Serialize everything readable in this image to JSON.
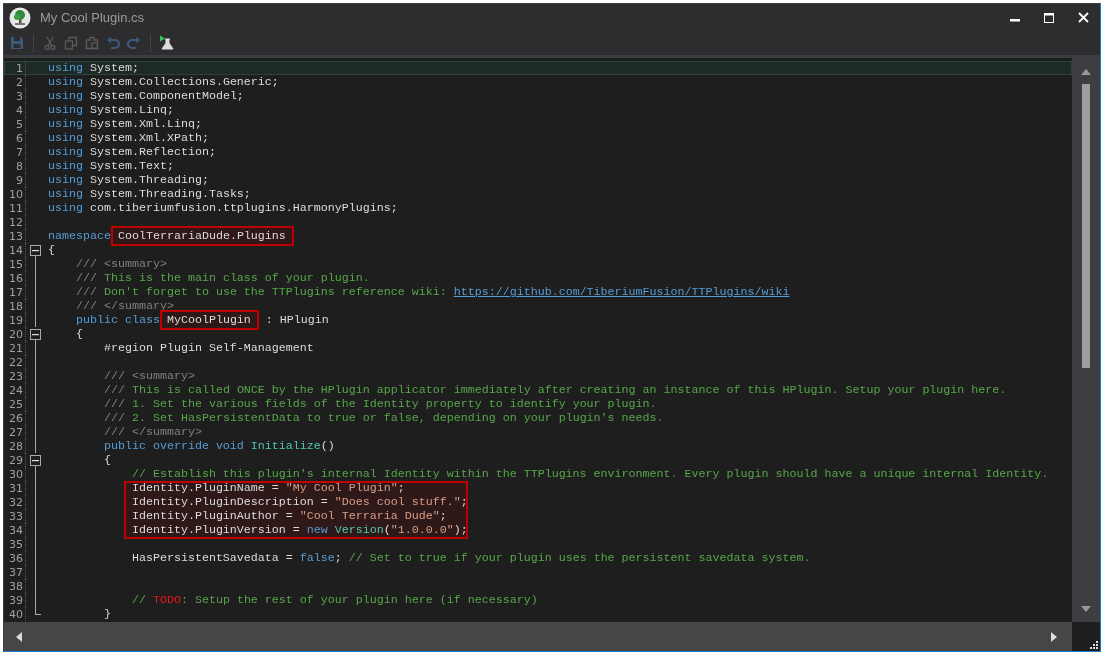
{
  "window": {
    "title": "My Cool Plugin.cs"
  },
  "editor": {
    "lines": [
      {
        "number": "1",
        "kind": "plain",
        "current": true,
        "boxed": false,
        "tokens": [
          {
            "kind": "keyword",
            "text": "using"
          },
          {
            "kind": "plain",
            "text": " System;"
          }
        ]
      },
      {
        "number": "2",
        "kind": "plain",
        "current": false,
        "boxed": false,
        "tokens": [
          {
            "kind": "keyword",
            "text": "using"
          },
          {
            "kind": "plain",
            "text": " System.Collections.Generic;"
          }
        ]
      },
      {
        "number": "3",
        "kind": "plain",
        "current": false,
        "boxed": false,
        "tokens": [
          {
            "kind": "keyword",
            "text": "using"
          },
          {
            "kind": "plain",
            "text": " System.ComponentModel;"
          }
        ]
      },
      {
        "number": "4",
        "kind": "plain",
        "current": false,
        "boxed": false,
        "tokens": [
          {
            "kind": "keyword",
            "text": "using"
          },
          {
            "kind": "plain",
            "text": " System.Linq;"
          }
        ]
      },
      {
        "number": "5",
        "kind": "plain",
        "current": false,
        "boxed": false,
        "tokens": [
          {
            "kind": "keyword",
            "text": "using"
          },
          {
            "kind": "plain",
            "text": " System.Xml.Linq;"
          }
        ]
      },
      {
        "number": "6",
        "kind": "plain",
        "current": false,
        "boxed": false,
        "tokens": [
          {
            "kind": "keyword",
            "text": "using"
          },
          {
            "kind": "plain",
            "text": " System.Xml.XPath;"
          }
        ]
      },
      {
        "number": "7",
        "kind": "plain",
        "current": false,
        "boxed": false,
        "tokens": [
          {
            "kind": "keyword",
            "text": "using"
          },
          {
            "kind": "plain",
            "text": " System.Reflection;"
          }
        ]
      },
      {
        "number": "8",
        "kind": "plain",
        "current": false,
        "boxed": false,
        "tokens": [
          {
            "kind": "keyword",
            "text": "using"
          },
          {
            "kind": "plain",
            "text": " System.Text;"
          }
        ]
      },
      {
        "number": "9",
        "kind": "plain",
        "current": false,
        "boxed": false,
        "tokens": [
          {
            "kind": "keyword",
            "text": "using"
          },
          {
            "kind": "plain",
            "text": " System.Threading;"
          }
        ]
      },
      {
        "number": "10",
        "kind": "plain",
        "current": false,
        "boxed": false,
        "tokens": [
          {
            "kind": "keyword",
            "text": "using"
          },
          {
            "kind": "plain",
            "text": " System.Threading.Tasks;"
          }
        ]
      },
      {
        "number": "11",
        "kind": "plain",
        "current": false,
        "boxed": false,
        "tokens": [
          {
            "kind": "keyword",
            "text": "using"
          },
          {
            "kind": "plain",
            "text": " com.tiberiumfusion.ttplugins.HarmonyPlugins;"
          }
        ]
      },
      {
        "number": "12",
        "kind": "plain",
        "current": false,
        "boxed": false
      },
      {
        "number": "13",
        "kind": "plain",
        "current": false,
        "boxed": false,
        "tokens": [
          {
            "kind": "keyword",
            "text": "namespace"
          },
          {
            "kind": "boxed",
            "text": "CoolTerrariaDude.Plugins"
          }
        ]
      },
      {
        "number": "14",
        "kind": "foldstart",
        "current": false,
        "boxed": false,
        "tokens": [
          {
            "kind": "plain",
            "text": "{"
          }
        ]
      },
      {
        "number": "15",
        "kind": "foldbody",
        "current": false,
        "boxed": false,
        "tokens": [
          {
            "kind": "doc",
            "text": "    /// <summary>"
          }
        ]
      },
      {
        "number": "16",
        "kind": "foldbody",
        "current": false,
        "boxed": false,
        "tokens": [
          {
            "kind": "doc",
            "text": "    /// "
          },
          {
            "kind": "comment",
            "text": "This is the main class of your plugin."
          }
        ]
      },
      {
        "number": "17",
        "kind": "foldbody",
        "current": false,
        "boxed": false,
        "tokens": [
          {
            "kind": "doc",
            "text": "    /// "
          },
          {
            "kind": "comment",
            "text": "Don't forget to use the TTPlugins reference wiki: "
          },
          {
            "kind": "link",
            "text": "https://github.com/TiberiumFusion/TTPlugins/wiki"
          }
        ]
      },
      {
        "number": "18",
        "kind": "foldbody",
        "current": false,
        "boxed": false,
        "tokens": [
          {
            "kind": "doc",
            "text": "    /// </summary>"
          }
        ]
      },
      {
        "number": "19",
        "kind": "foldbody",
        "current": false,
        "boxed": false,
        "tokens": [
          {
            "kind": "keyword",
            "text": "    public class"
          },
          {
            "kind": "boxed",
            "text": "MyCoolPlugin"
          },
          {
            "kind": "plain",
            "text": " : HPlugin"
          }
        ]
      },
      {
        "number": "20",
        "kind": "foldstart",
        "current": false,
        "boxed": false,
        "tokens": [
          {
            "kind": "plain",
            "text": "    {"
          }
        ]
      },
      {
        "number": "21",
        "kind": "foldbody",
        "current": false,
        "boxed": false,
        "tokens": [
          {
            "kind": "plain",
            "text": "        #region Plugin Self-Management"
          }
        ]
      },
      {
        "number": "22",
        "kind": "foldbody",
        "current": false,
        "boxed": false
      },
      {
        "number": "23",
        "kind": "foldbody",
        "current": false,
        "boxed": false,
        "tokens": [
          {
            "kind": "doc",
            "text": "        /// <summary>"
          }
        ]
      },
      {
        "number": "24",
        "kind": "foldbody",
        "current": false,
        "boxed": false,
        "tokens": [
          {
            "kind": "doc",
            "text": "        /// "
          },
          {
            "kind": "comment",
            "text": "This is called ONCE by the HPlugin applicator immediately after creating an instance of this HPlugin. Setup your plugin here."
          }
        ]
      },
      {
        "number": "25",
        "kind": "foldbody",
        "current": false,
        "boxed": false,
        "tokens": [
          {
            "kind": "doc",
            "text": "        /// "
          },
          {
            "kind": "comment",
            "text": "1. Set the various fields of the Identity property to identify your plugin."
          }
        ]
      },
      {
        "number": "26",
        "kind": "foldbody",
        "current": false,
        "boxed": false,
        "tokens": [
          {
            "kind": "doc",
            "text": "        /// "
          },
          {
            "kind": "comment",
            "text": "2. Set HasPersistentData to true or false, depending on your plugin's needs."
          }
        ]
      },
      {
        "number": "27",
        "kind": "foldbody",
        "current": false,
        "boxed": false,
        "tokens": [
          {
            "kind": "doc",
            "text": "        /// </summary>"
          }
        ]
      },
      {
        "number": "28",
        "kind": "foldbody",
        "current": false,
        "boxed": false,
        "tokens": [
          {
            "kind": "keyword",
            "text": "        public override void "
          },
          {
            "kind": "type",
            "text": "Initialize"
          },
          {
            "kind": "plain",
            "text": "()"
          }
        ]
      },
      {
        "number": "29",
        "kind": "foldstart",
        "current": false,
        "boxed": false,
        "tokens": [
          {
            "kind": "plain",
            "text": "        {"
          }
        ]
      },
      {
        "number": "30",
        "kind": "foldbody",
        "current": false,
        "boxed": false,
        "tokens": [
          {
            "kind": "comment",
            "text": "            // Establish this plugin's internal Identity within the TTPlugins environment. Every plugin should have a unique internal Identity."
          }
        ]
      },
      {
        "number": "31",
        "kind": "foldbody",
        "current": false,
        "boxed": true,
        "tokens": [
          {
            "kind": "plain",
            "text": "            Identity.PluginName = "
          },
          {
            "kind": "string",
            "text": "\"My Cool Plugin\""
          },
          {
            "kind": "plain",
            "text": ";"
          }
        ]
      },
      {
        "number": "32",
        "kind": "foldbody",
        "current": false,
        "boxed": true,
        "tokens": [
          {
            "kind": "plain",
            "text": "            Identity.PluginDescription = "
          },
          {
            "kind": "string",
            "text": "\"Does cool stuff.\""
          },
          {
            "kind": "plain",
            "text": ";"
          }
        ]
      },
      {
        "number": "33",
        "kind": "foldbody",
        "current": false,
        "boxed": true,
        "tokens": [
          {
            "kind": "plain",
            "text": "            Identity.PluginAuthor = "
          },
          {
            "kind": "string",
            "text": "\"Cool Terraria Dude\""
          },
          {
            "kind": "plain",
            "text": ";"
          }
        ]
      },
      {
        "number": "34",
        "kind": "foldbody",
        "current": false,
        "boxed": true,
        "tokens": [
          {
            "kind": "plain",
            "text": "            Identity.PluginVersion = "
          },
          {
            "kind": "keyword",
            "text": "new "
          },
          {
            "kind": "type",
            "text": "Version"
          },
          {
            "kind": "plain",
            "text": "("
          },
          {
            "kind": "string",
            "text": "\"1.0.0.0\""
          },
          {
            "kind": "plain",
            "text": ");"
          }
        ]
      },
      {
        "number": "35",
        "kind": "foldbody",
        "current": false,
        "boxed": false
      },
      {
        "number": "36",
        "kind": "foldbody",
        "current": false,
        "boxed": false,
        "tokens": [
          {
            "kind": "plain",
            "text": "            HasPersistentSavedata = "
          },
          {
            "kind": "keyword",
            "text": "false"
          },
          {
            "kind": "plain",
            "text": "; "
          },
          {
            "kind": "comment",
            "text": "// Set to true if your plugin uses the persistent savedata system."
          }
        ]
      },
      {
        "number": "37",
        "kind": "foldbody",
        "current": false,
        "boxed": false
      },
      {
        "number": "38",
        "kind": "foldbody",
        "current": false,
        "boxed": false
      },
      {
        "number": "39",
        "kind": "foldbody",
        "current": false,
        "boxed": false,
        "tokens": [
          {
            "kind": "comment",
            "text": "            // "
          },
          {
            "kind": "todo",
            "text": "TODO"
          },
          {
            "kind": "comment",
            "text": ": Setup the rest of your plugin here (if necessary)"
          }
        ]
      },
      {
        "number": "40",
        "kind": "foldend",
        "current": false,
        "boxed": false,
        "tokens": [
          {
            "kind": "plain",
            "text": "        }"
          }
        ]
      }
    ]
  }
}
